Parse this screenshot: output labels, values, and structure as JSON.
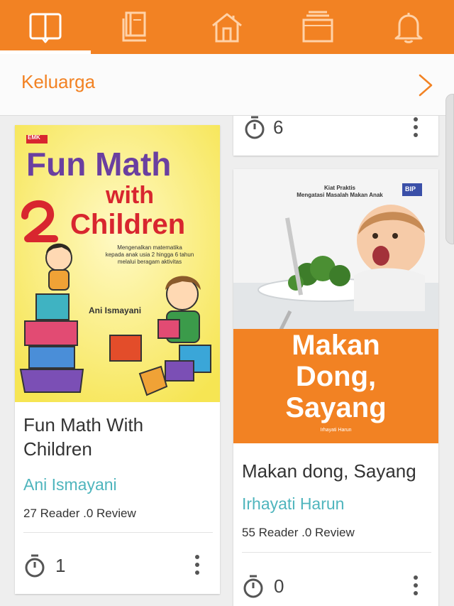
{
  "app": {
    "tabs": [
      {
        "icon": "open-book-icon",
        "selected": true
      },
      {
        "icon": "book-stack-icon",
        "selected": false
      },
      {
        "icon": "home-icon",
        "selected": false
      },
      {
        "icon": "inbox-tray-icon",
        "selected": false
      },
      {
        "icon": "bell-icon",
        "selected": false
      }
    ],
    "accent_color": "#f28223",
    "link_color": "#4fb5bd"
  },
  "category": {
    "title": "Keluarga"
  },
  "partial_card": {
    "count": "6"
  },
  "books": [
    {
      "cover": {
        "publisher": "EMK",
        "title_line1": "Fun Math",
        "title_line2": "with",
        "title_line3": "Children",
        "subtitle_line1": "Mengenalkan matematika",
        "subtitle_line2": "kepada anak usia 2 hingga 6 tahun",
        "subtitle_line3": "melalui beragam aktivitas",
        "author": "Ani Ismayani"
      },
      "title": "Fun Math With Children",
      "author": "Ani Ismayani",
      "stats": "27 Reader .0 Review",
      "count": "1"
    },
    {
      "cover": {
        "kicker_line1": "Kiat Praktis",
        "kicker_line2": "Mengatasi Masalah Makan Anak",
        "publisher": "BIP",
        "title_line1": "Makan",
        "title_line2": "Dong,",
        "title_line3": "Sayang",
        "author": "Irhayati Harun"
      },
      "title": "Makan dong, Sayang",
      "author": "Irhayati Harun",
      "stats": "55 Reader .0 Review",
      "count": "0"
    }
  ]
}
